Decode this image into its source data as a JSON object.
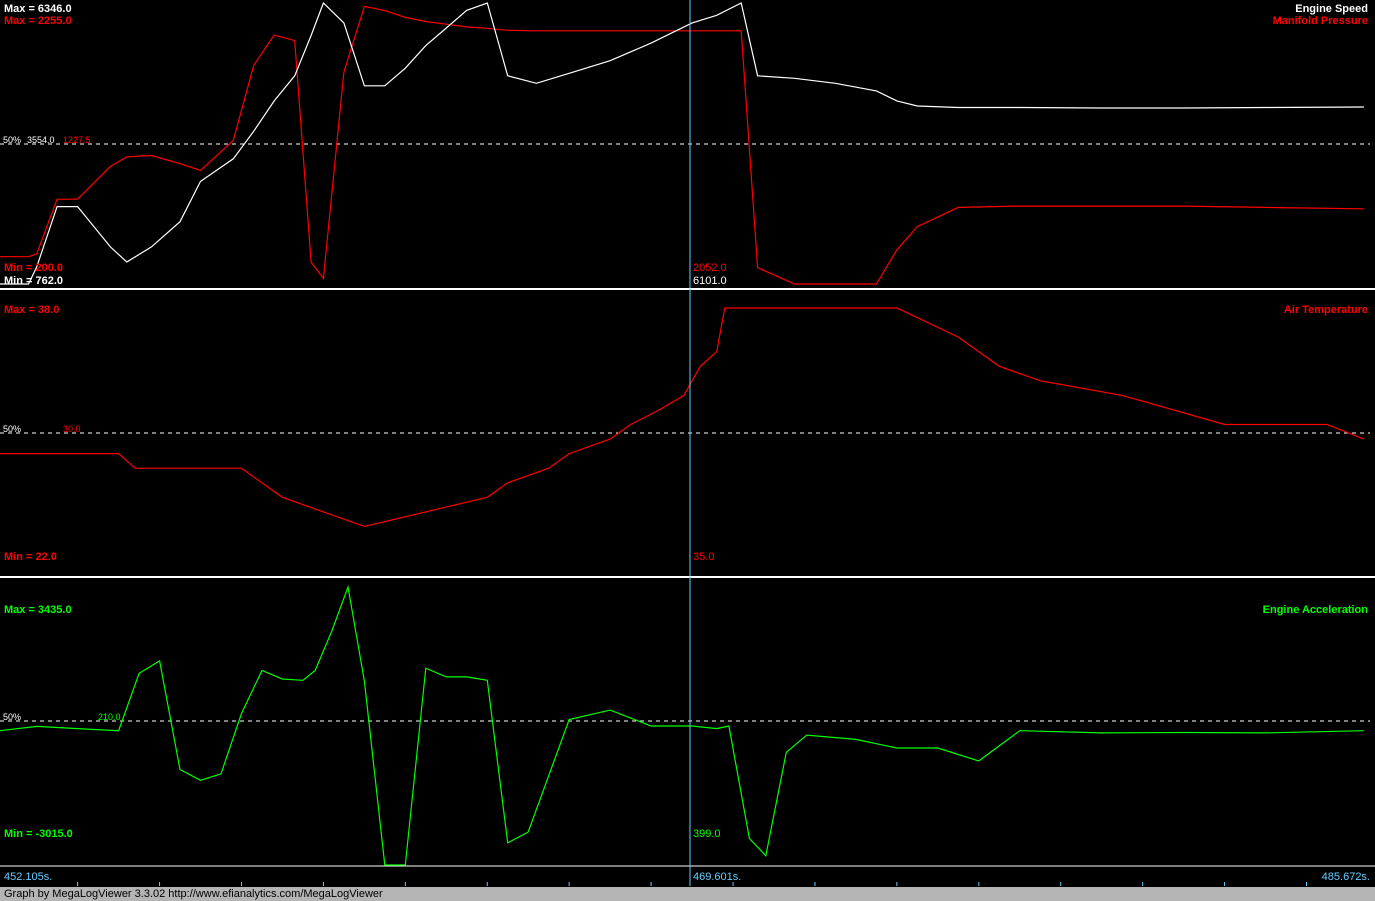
{
  "colors": {
    "background": "#000000",
    "engine_speed": "#ffffff",
    "manifold_pressure": "#ff0000",
    "air_temperature": "#ff0000",
    "engine_acceleration": "#00ff00",
    "cursor": "#66ccff",
    "time_axis_text": "#66ccff",
    "divider": "#ffffff",
    "midline": "#ffffff"
  },
  "cursor": {
    "time_label": "469.601s."
  },
  "time_axis": {
    "start_label": "452.105s.",
    "end_label": "485.672s.",
    "start": 452.105,
    "end": 485.672
  },
  "footer": {
    "text": "Graph by MegaLogViewer 3.3.02 http://www.efianalytics.com/MegaLogViewer"
  },
  "chart_data": [
    {
      "type": "line",
      "panel": 1,
      "x": [
        452.105,
        452.8,
        453.0,
        453.5,
        454.0,
        454.8,
        455.2,
        455.8,
        456.5,
        457.0,
        457.8,
        458.3,
        458.8,
        459.3,
        459.7,
        460.0,
        460.5,
        461.0,
        461.5,
        462.0,
        462.5,
        463.0,
        463.5,
        464.0,
        464.5,
        465.2,
        466.0,
        467.0,
        468.0,
        469.0,
        469.601,
        470.2,
        470.6,
        471.5,
        472.5,
        473.5,
        474.0,
        474.5,
        475.5,
        477.0,
        479.0,
        481.0,
        483.0,
        485.4
      ],
      "series": [
        {
          "name": "Engine Speed",
          "color": "#ffffff",
          "values": [
            762,
            762,
            1100,
            2300,
            2300,
            1500,
            1200,
            1500,
            2000,
            2800,
            3250,
            3800,
            4400,
            4900,
            5700,
            6346,
            5950,
            4700,
            4700,
            5050,
            5500,
            5850,
            6200,
            6346,
            4900,
            4750,
            4950,
            5200,
            5550,
            5950,
            6101,
            6346,
            4900,
            4850,
            4750,
            4600,
            4400,
            4300,
            4270,
            4270,
            4260,
            4260,
            4270,
            4280
          ]
        },
        {
          "name": "Manifold Pressure",
          "color": "#ff0000",
          "values": [
            400,
            400,
            420,
            820,
            820,
            1060,
            1130,
            1140,
            1080,
            1030,
            1250,
            1800,
            2020,
            1980,
            360,
            240,
            1750,
            2230,
            2200,
            2150,
            2120,
            2100,
            2080,
            2070,
            2055,
            2052,
            2052,
            2052,
            2052,
            2052,
            2052,
            2052,
            320,
            200,
            200,
            200,
            450,
            620,
            760,
            770,
            770,
            770,
            760,
            750
          ]
        }
      ],
      "labels": {
        "engine_speed": {
          "title": "Engine Speed",
          "max": "Max = 6346.0",
          "min": "Min = 762.0",
          "mid": "3554.0",
          "cursor": "6101.0"
        },
        "manifold_pressure": {
          "title": "Manifold Pressure",
          "max": "Max = 2255.0",
          "min": "Min = 200.0",
          "mid": "1227.5",
          "cursor": "2052.0"
        }
      },
      "midline_label": "50%",
      "ylim_speed": [
        762,
        6346
      ],
      "ylim_pressure": [
        200,
        2255
      ]
    },
    {
      "type": "line",
      "panel": 2,
      "x": [
        452.105,
        455.0,
        455.4,
        458.0,
        458.5,
        459.0,
        460.0,
        461.0,
        464.0,
        464.5,
        465.5,
        466.0,
        467.0,
        467.5,
        468.2,
        468.8,
        469.2,
        469.601,
        469.8,
        471.0,
        472.0,
        473.0,
        474.0,
        475.5,
        476.5,
        477.5,
        479.5,
        482.0,
        483.5,
        484.5,
        485.4
      ],
      "series": [
        {
          "name": "Air Temperature",
          "color": "#ff0000",
          "values": [
            28,
            28,
            27,
            27,
            26,
            25,
            24,
            23,
            25,
            26,
            27,
            28,
            29,
            30,
            31,
            32,
            34,
            35,
            38,
            38,
            38,
            38,
            38,
            36,
            34,
            33,
            32,
            30,
            30,
            30,
            29
          ]
        }
      ],
      "labels": {
        "air_temperature": {
          "title": "Air Temperature",
          "max": "Max = 38.0",
          "min": "Min = 22.0",
          "mid": "30.0",
          "cursor": "35.0"
        }
      },
      "midline_label": "50%",
      "ylim": [
        22,
        38
      ]
    },
    {
      "type": "line",
      "panel": 3,
      "x": [
        452.105,
        453.0,
        454.0,
        455.0,
        455.5,
        456.0,
        456.5,
        457.0,
        457.5,
        458.0,
        458.5,
        459.0,
        459.5,
        459.8,
        460.2,
        460.6,
        461.0,
        461.5,
        462.0,
        462.5,
        463.0,
        463.5,
        464.0,
        464.5,
        465.0,
        466.0,
        467.0,
        468.0,
        469.0,
        469.601,
        469.9,
        470.4,
        470.8,
        471.3,
        471.8,
        473.0,
        474.0,
        475.0,
        476.0,
        477.0,
        479.0,
        481.0,
        483.0,
        485.4
      ],
      "series": [
        {
          "name": "Engine Acceleration",
          "color": "#00ff00",
          "values": [
            100,
            200,
            150,
            100,
            1430,
            1720,
            -800,
            -1050,
            -900,
            500,
            1500,
            1300,
            1270,
            1500,
            2400,
            3435,
            1250,
            -3015,
            -3015,
            1550,
            1350,
            1350,
            1270,
            -2500,
            -2250,
            360,
            580,
            210,
            210,
            150,
            210,
            -2400,
            -2800,
            -400,
            0,
            -100,
            -300,
            -300,
            -600,
            100,
            50,
            60,
            50,
            100
          ]
        }
      ],
      "labels": {
        "engine_acceleration": {
          "title": "Engine Acceleration",
          "max": "Max = 3435.0",
          "min": "Min = -3015.0",
          "mid": "210.0",
          "cursor": "399.0"
        }
      },
      "midline_label": "50%",
      "ylim": [
        -3015,
        3435
      ]
    }
  ]
}
